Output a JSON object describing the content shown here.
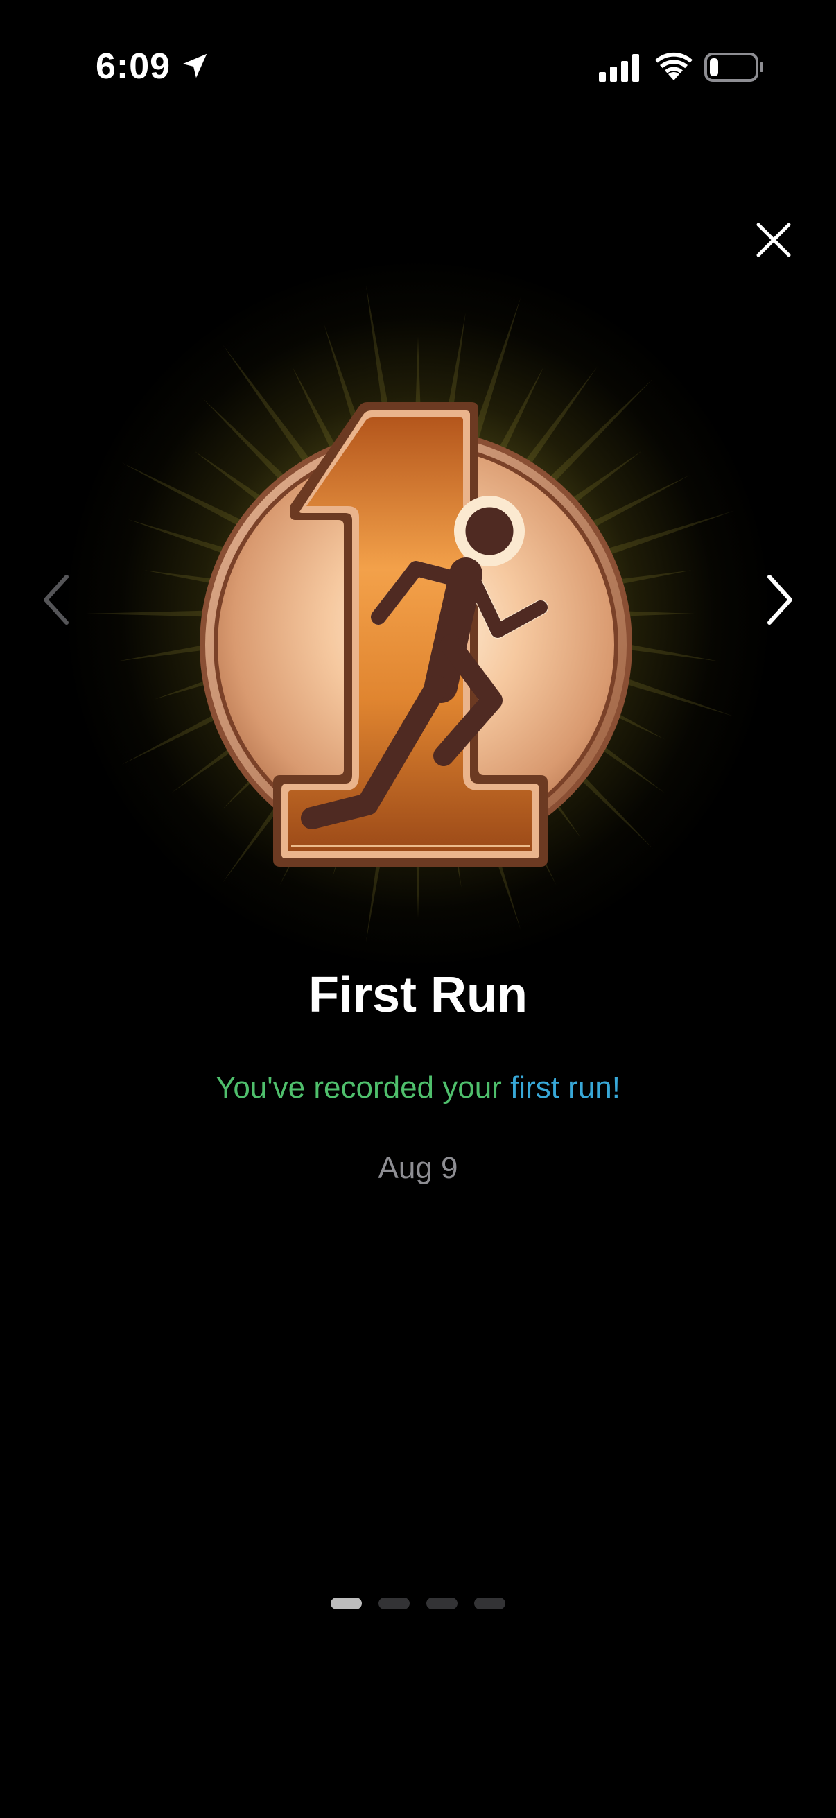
{
  "status_bar": {
    "time": "6:09",
    "icons": [
      "location-arrow-icon",
      "cellular-signal-icon",
      "wifi-icon",
      "battery-icon"
    ]
  },
  "header": {
    "close_icon": "close-icon"
  },
  "navigation": {
    "prev_icon": "chevron-left-icon",
    "next_icon": "chevron-right-icon"
  },
  "achievement": {
    "badge_icon": "first-run-badge-icon",
    "title": "First Run",
    "message_part1": "You've recorded your ",
    "message_part2": "first run!",
    "date": "Aug 9"
  },
  "pagination": {
    "total": 4,
    "active_index": 0
  },
  "colors": {
    "background": "#000000",
    "message_green": "#4fbf6c",
    "message_blue": "#38a8d8",
    "date_gray": "#8e8e93",
    "badge_bronze": "#c97a3a",
    "glow": "#d7cd5a"
  }
}
